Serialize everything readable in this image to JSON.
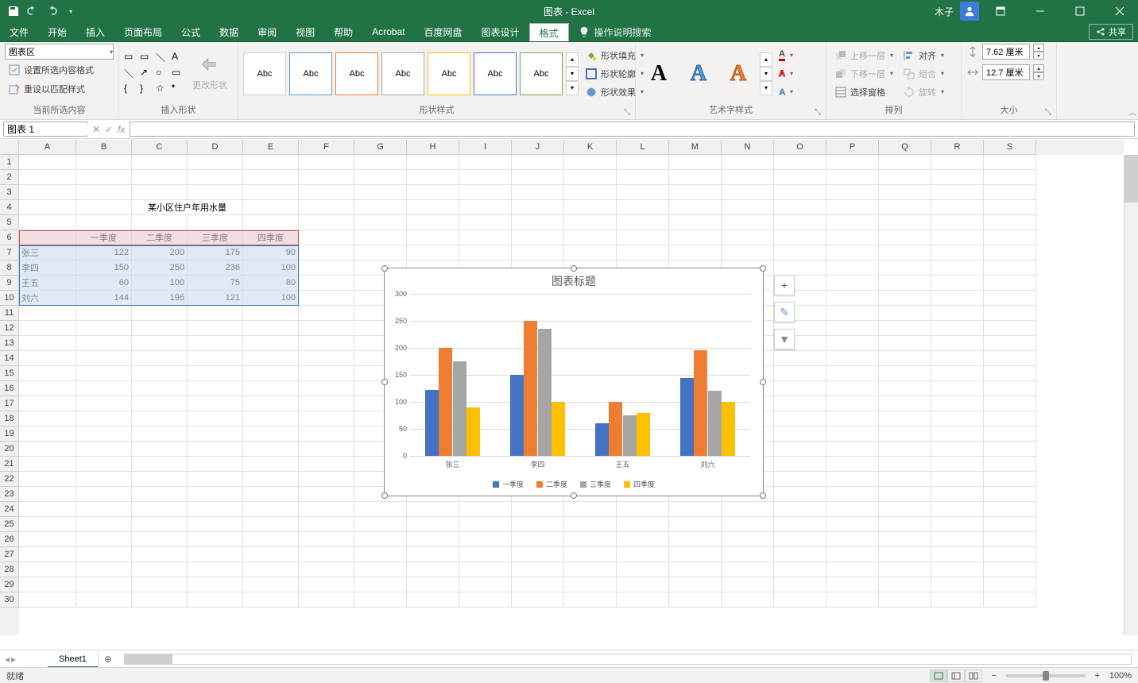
{
  "app_title": "图表 - Excel",
  "user_name": "木子",
  "share_label": "共享",
  "tabs": [
    "文件",
    "开始",
    "插入",
    "页面布局",
    "公式",
    "数据",
    "审阅",
    "视图",
    "帮助",
    "Acrobat",
    "百度网盘",
    "图表设计",
    "格式"
  ],
  "active_tab": "格式",
  "tell_me": "操作说明搜索",
  "ribbon": {
    "curr_sel_group": "当前所选内容",
    "selection_dropdown": "图表区",
    "format_selection": "设置所选内容格式",
    "reset_match": "重设以匹配样式",
    "insert_shapes_group": "插入形状",
    "change_shape": "更改形状",
    "shape_styles_group": "形状样式",
    "shape_fill": "形状填充",
    "shape_outline": "形状轮廓",
    "shape_effects": "形状效果",
    "abc": "Abc",
    "wordart_group": "艺术字样式",
    "wordart_letter": "A",
    "text_fill": "",
    "arrange_group": "排列",
    "bring_forward": "上移一层",
    "send_backward": "下移一层",
    "selection_pane": "选择窗格",
    "align": "对齐",
    "group": "组合",
    "rotate": "旋转",
    "size_group": "大小",
    "height": "7.62 厘米",
    "width": "12.7 厘米"
  },
  "name_box": "图表 1",
  "sheet": {
    "title_cell": "某小区住户年用水量",
    "col_labels": [
      "一季度",
      "二季度",
      "三季度",
      "四季度"
    ],
    "row_labels": [
      "张三",
      "李四",
      "王五",
      "刘六"
    ],
    "values": [
      [
        122,
        200,
        175,
        90
      ],
      [
        150,
        250,
        236,
        100
      ],
      [
        60,
        100,
        75,
        80
      ],
      [
        144,
        196,
        121,
        100
      ]
    ]
  },
  "columns": [
    "A",
    "B",
    "C",
    "D",
    "E",
    "F",
    "G",
    "H",
    "I",
    "J",
    "K",
    "L",
    "M",
    "N",
    "O",
    "P",
    "Q",
    "R",
    "S"
  ],
  "sheet_tab": "Sheet1",
  "status": "就绪",
  "zoom": "100%",
  "chart_data": {
    "type": "bar",
    "title": "图表标题",
    "categories": [
      "张三",
      "李四",
      "王五",
      "刘六"
    ],
    "series": [
      {
        "name": "一季度",
        "color": "#4472c4",
        "values": [
          122,
          150,
          60,
          144
        ]
      },
      {
        "name": "二季度",
        "color": "#ed7d31",
        "values": [
          200,
          250,
          100,
          196
        ]
      },
      {
        "name": "三季度",
        "color": "#a5a5a5",
        "values": [
          175,
          236,
          75,
          121
        ]
      },
      {
        "name": "四季度",
        "color": "#ffc000",
        "values": [
          90,
          100,
          80,
          100
        ]
      }
    ],
    "ylim": [
      0,
      300
    ],
    "yticks": [
      0,
      50,
      100,
      150,
      200,
      250,
      300
    ]
  }
}
